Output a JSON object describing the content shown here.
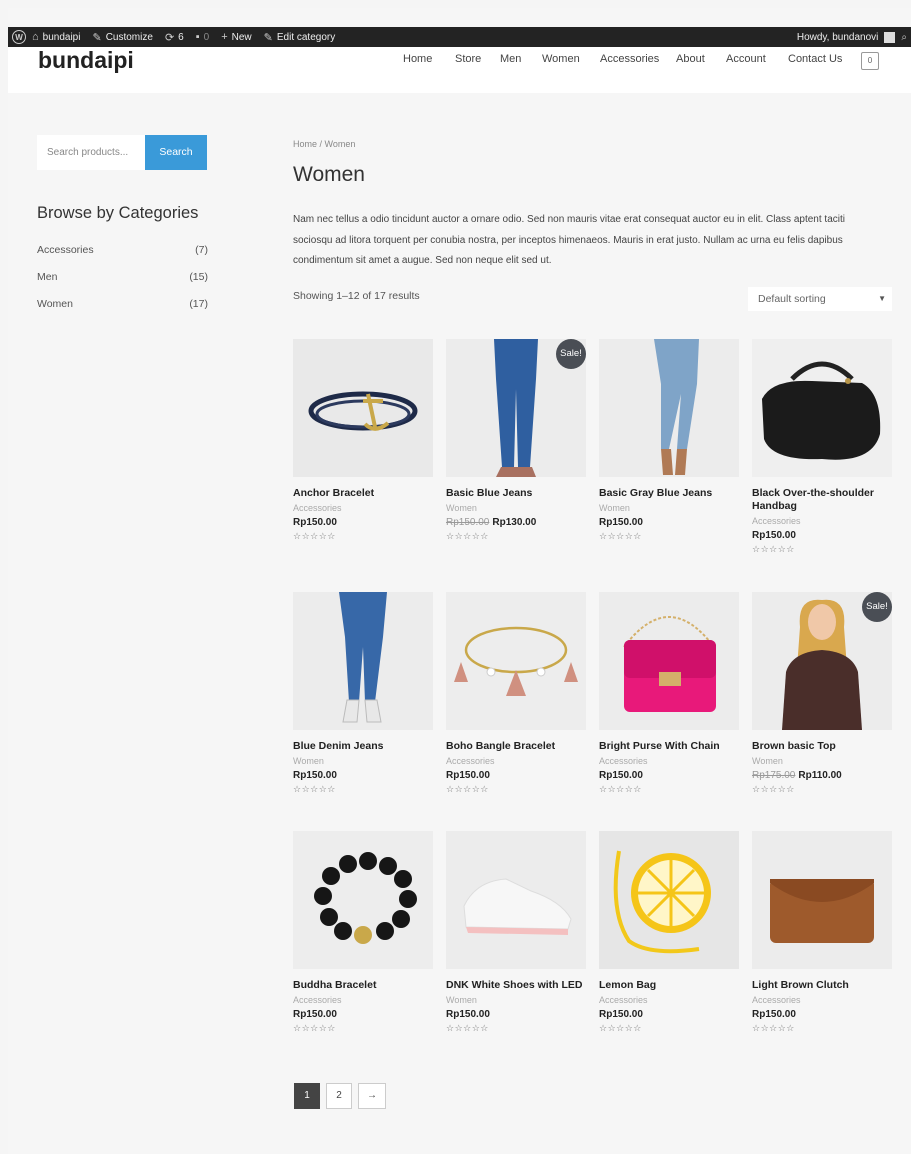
{
  "adminbar": {
    "site": "bundaipi",
    "customize": "Customize",
    "updates": "6",
    "comments": "0",
    "new": "New",
    "edit": "Edit category",
    "howdy": "Howdy, bundanovi"
  },
  "header": {
    "title": "bundaipi",
    "nav": [
      "Home",
      "Store",
      "Men",
      "Women",
      "Accessories",
      "About",
      "Account",
      "Contact Us"
    ],
    "cart_count": "0"
  },
  "sidebar": {
    "search_placeholder": "Search products...",
    "search_button": "Search",
    "browse_title": "Browse by Categories",
    "categories": [
      {
        "name": "Accessories",
        "count": "(7)"
      },
      {
        "name": "Men",
        "count": "(15)"
      },
      {
        "name": "Women",
        "count": "(17)"
      }
    ]
  },
  "main": {
    "breadcrumb": "Home / Women",
    "title": "Women",
    "description": "Nam nec tellus a odio tincidunt auctor a ornare odio. Sed non mauris vitae erat consequat auctor eu in elit. Class aptent taciti sociosqu ad litora torquent per conubia nostra, per inceptos himenaeos. Mauris in erat justo. Nullam ac urna eu felis dapibus condimentum sit amet a augue. Sed non neque elit sed ut.",
    "result_count": "Showing 1–12 of 17 results",
    "sort": "Default sorting",
    "sale_label": "Sale!",
    "stars": "☆☆☆☆☆"
  },
  "products": [
    {
      "name": "Anchor Bracelet",
      "category": "Accessories",
      "price": "Rp150.00",
      "old_price": "",
      "sale": false,
      "icon": "bracelet-icon"
    },
    {
      "name": "Basic Blue Jeans",
      "category": "Women",
      "price": "Rp130.00",
      "old_price": "Rp150.00",
      "sale": true,
      "icon": "jeans-icon"
    },
    {
      "name": "Basic Gray Blue Jeans",
      "category": "Women",
      "price": "Rp150.00",
      "old_price": "",
      "sale": false,
      "icon": "jeans-icon"
    },
    {
      "name": "Black Over-the-shoulder Handbag",
      "category": "Accessories",
      "price": "Rp150.00",
      "old_price": "",
      "sale": false,
      "icon": "handbag-icon"
    },
    {
      "name": "Blue Denim Jeans",
      "category": "Women",
      "price": "Rp150.00",
      "old_price": "",
      "sale": false,
      "icon": "jeans-icon"
    },
    {
      "name": "Boho Bangle Bracelet",
      "category": "Accessories",
      "price": "Rp150.00",
      "old_price": "",
      "sale": false,
      "icon": "bangle-icon"
    },
    {
      "name": "Bright Purse With Chain",
      "category": "Accessories",
      "price": "Rp150.00",
      "old_price": "",
      "sale": false,
      "icon": "purse-icon"
    },
    {
      "name": "Brown basic Top",
      "category": "Women",
      "price": "Rp110.00",
      "old_price": "Rp175.00",
      "sale": true,
      "icon": "top-icon"
    },
    {
      "name": "Buddha Bracelet",
      "category": "Accessories",
      "price": "Rp150.00",
      "old_price": "",
      "sale": false,
      "icon": "beads-icon"
    },
    {
      "name": "DNK White Shoes with LED",
      "category": "Women",
      "price": "Rp150.00",
      "old_price": "",
      "sale": false,
      "icon": "shoe-icon"
    },
    {
      "name": "Lemon Bag",
      "category": "Accessories",
      "price": "Rp150.00",
      "old_price": "",
      "sale": false,
      "icon": "lemon-bag-icon"
    },
    {
      "name": "Light Brown Clutch",
      "category": "Accessories",
      "price": "Rp150.00",
      "old_price": "",
      "sale": false,
      "icon": "clutch-icon"
    }
  ],
  "pagination": [
    "1",
    "2",
    "→"
  ]
}
